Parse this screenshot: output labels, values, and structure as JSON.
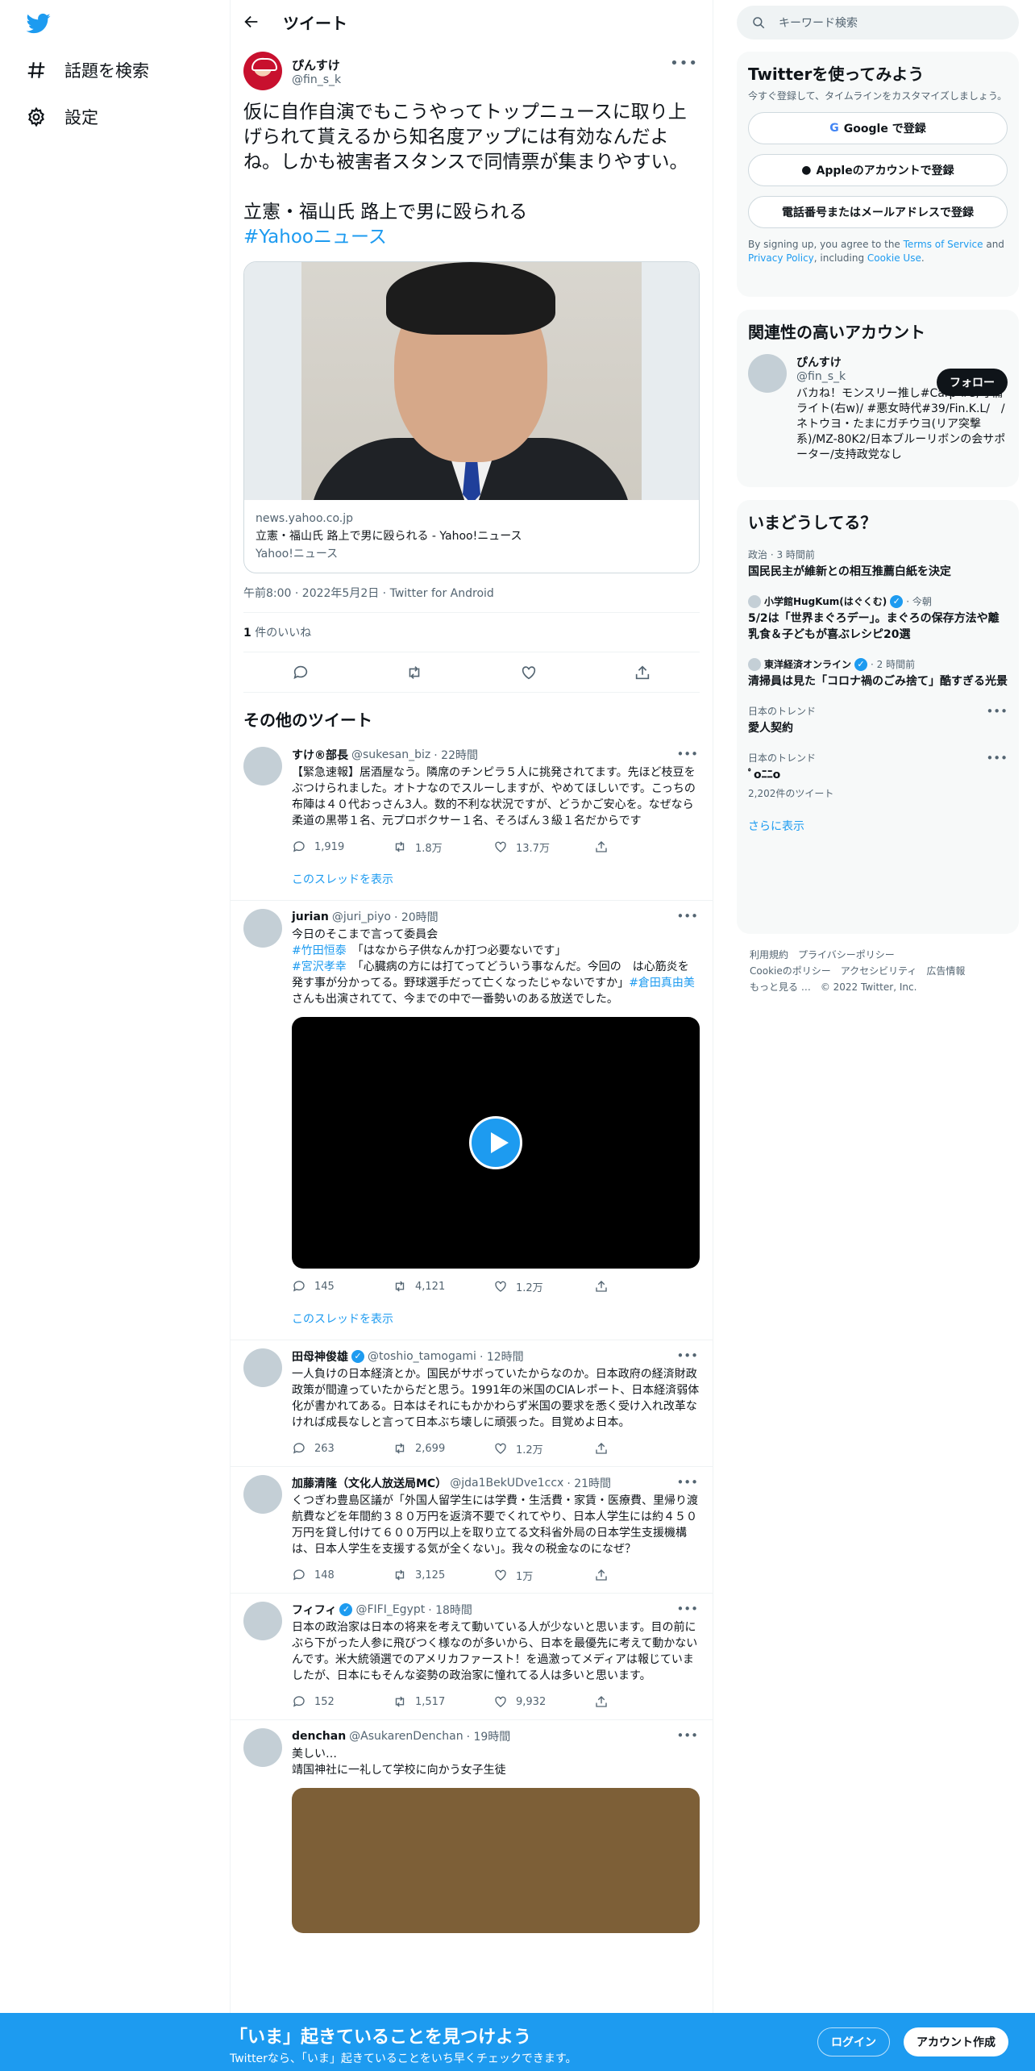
{
  "nav": {
    "explore": "話題を検索",
    "settings": "設定"
  },
  "header": {
    "title": "ツイート"
  },
  "tweet": {
    "name": "ぴんすけ",
    "handle": "@fin_s_k",
    "text": "仮に自作自演でもこうやってトップニュースに取り上げられて貰えるから知名度アップには有効なんだよね。しかも被害者スタンスで同情票が集まりやすい。",
    "news_title": "立憲・福山氏 路上で男に殴られる",
    "hashtag": "#Yahooニュース",
    "card": {
      "domain": "news.yahoo.co.jp",
      "title": "立憲・福山氏 路上で男に殴られる - Yahoo!ニュース",
      "source": "Yahoo!ニュース"
    },
    "timestamp": "午前8:00 · 2022年5月2日 · Twitter for Android",
    "likes_count": "1",
    "likes_label": " 件のいいね"
  },
  "more_tweets_title": "その他のツイート",
  "tweets": [
    {
      "name": "すけ®部長",
      "handle": "@sukesan_biz",
      "time": "· 22時間",
      "text": "【緊急速報】居酒屋なう。隣席のチンピラ５人に挑発されてます。先ほど枝豆をぶつけられました。オトナなのでスルーしますが、やめてほしいです。こっちの布陣は４０代おっさん3人。数的不利な状況ですが、どうかご安心を。なぜなら柔道の黒帯１名、元プロボクサー１名、そろばん３級１名だからです",
      "reply": "1,919",
      "retweet": "1.8万",
      "like": "13.7万",
      "thread": "このスレッドを表示"
    },
    {
      "name": "jurian",
      "handle": "@juri_piyo",
      "time": "· 20時間",
      "line1": "今日のそこまで言って委員会",
      "tag1": "#竹田恒泰",
      "q1": "「はなから子供なんか打つ必要ないです」",
      "tag2": "#宮沢孝幸",
      "q2": "「心臓病の方には打てってどういう事なんだ。今回の　は心筋炎を発す事が分かってる。野球選手だって亡くなったじゃないですか」",
      "tag3": "#倉田真由美",
      "q3": "さんも出演されてて、今までの中で一番勢いのある放送でした。",
      "reply": "145",
      "retweet": "4,121",
      "like": "1.2万",
      "thread": "このスレッドを表示"
    },
    {
      "name": "田母神俊雄",
      "handle": "@toshio_tamogami",
      "time": "· 12時間",
      "text": "一人負けの日本経済とか。国民がサボっていたからなのか。日本政府の経済財政政策が間違っていたからだと思う。1991年の米国のCIAレポート、日本経済弱体化が書かれてある。日本はそれにもかかわらず米国の要求を悉く受け入れ改革なければ成長なしと言って日本ぶち壊しに頑張った。目覚めよ日本。",
      "reply": "263",
      "retweet": "2,699",
      "like": "1.2万"
    },
    {
      "name": "加藤清隆（文化人放送局MC）",
      "handle": "@jda1BekUDve1ccx",
      "time": "· 21時間",
      "text": "くつぎわ豊島区議が「外国人留学生には学費・生活費・家賃・医療費、里帰り渡航費などを年間約３８０万円を返済不要でくれてやり、日本人学生には約４５０万円を貸し付けて６００万円以上を取り立てる文科省外局の日本学生支援機構は、日本人学生を支援する気が全くない」。我々の税金なのになぜ？",
      "reply": "148",
      "retweet": "3,125",
      "like": "1万"
    },
    {
      "name": "フィフィ",
      "handle": "@FIFI_Egypt",
      "time": "· 18時間",
      "text": "日本の政治家は日本の将来を考えて動いている人が少ないと思います。目の前にぶら下がった人参に飛びつく様なのが多いから、日本を最優先に考えて動かないんです。米大統領選でのアメリカファースト！を過激ってメディアは報じていましたが、日本にもそんな姿勢の政治家に憧れてる人は多いと思います。",
      "reply": "152",
      "retweet": "1,517",
      "like": "9,932"
    },
    {
      "name": "denchan",
      "handle": "@AsukarenDenchan",
      "time": "· 19時間",
      "line1": "美しい…",
      "line2": "靖国神社に一礼して学校に向かう女子生徒"
    }
  ],
  "right": {
    "search_placeholder": "キーワード検索",
    "signup": {
      "title": "Twitterを使ってみよう",
      "sub": "今すぐ登録して、タイムラインをカスタマイズしましょう。",
      "google": "Google で登録",
      "apple": "Appleのアカウントで登録",
      "phone": "電話番号またはメールアドレスで登録",
      "terms_pre": "By signing up, you agree to the ",
      "terms": "Terms of Service",
      "and": " and ",
      "privacy": "Privacy Policy",
      "including": ", including ",
      "cookie": "Cookie Use",
      "dot": "."
    },
    "related": {
      "title": "関連性の高いアカウント",
      "name": "ぴんすけ",
      "handle": "@fin_s_k",
      "follow": "フォロー",
      "bio": "バカね！モンスリー推し#Carp #5/守備ライト(右w)/ #悪女時代#39/Fin.K.L/　/　ネトウヨ・たまにガチウヨ(リア突撃系)/MZ-80K2/日本ブルーリボンの会サポーター/支持政党なし"
    },
    "trends": {
      "title": "いまどうしてる？",
      "items": [
        {
          "cat": "政治 · 3 時間前",
          "title": "国民民主が維新との相互推薦白紙を決定"
        },
        {
          "src": "小学館HugKum(はぐくむ)",
          "time": "· 今朝",
          "title": "5/2は「世界まぐろデー」。まぐろの保存方法や離乳食＆子どもが喜ぶレシピ20選"
        },
        {
          "src": "東洋経済オンライン",
          "time": "· 2 時間前",
          "title": "清掃員は見た「コロナ禍のごみ捨て」酷すぎる光景"
        },
        {
          "cat": "日本のトレンド",
          "title": "愛人契約"
        },
        {
          "cat": "日本のトレンド",
          "title": "ﾟoﾆﾆo",
          "count": "2,202件のツイート"
        }
      ],
      "show_more": "さらに表示"
    },
    "footer": {
      "l1": "利用規約　プライバシーポリシー",
      "l2": "Cookieのポリシー　アクセシビリティ　広告情報",
      "l3": "もっと見る …　© 2022 Twitter, Inc."
    }
  },
  "bottombar": {
    "title": "「いま」起きていることを見つけよう",
    "sub": "Twitterなら、「いま」起きていることをいち早くチェックできます。",
    "login": "ログイン",
    "signup": "アカウント作成"
  },
  "colors": {
    "accent": "#1d9bf0",
    "text": "#0f1419",
    "muted": "#536471"
  }
}
